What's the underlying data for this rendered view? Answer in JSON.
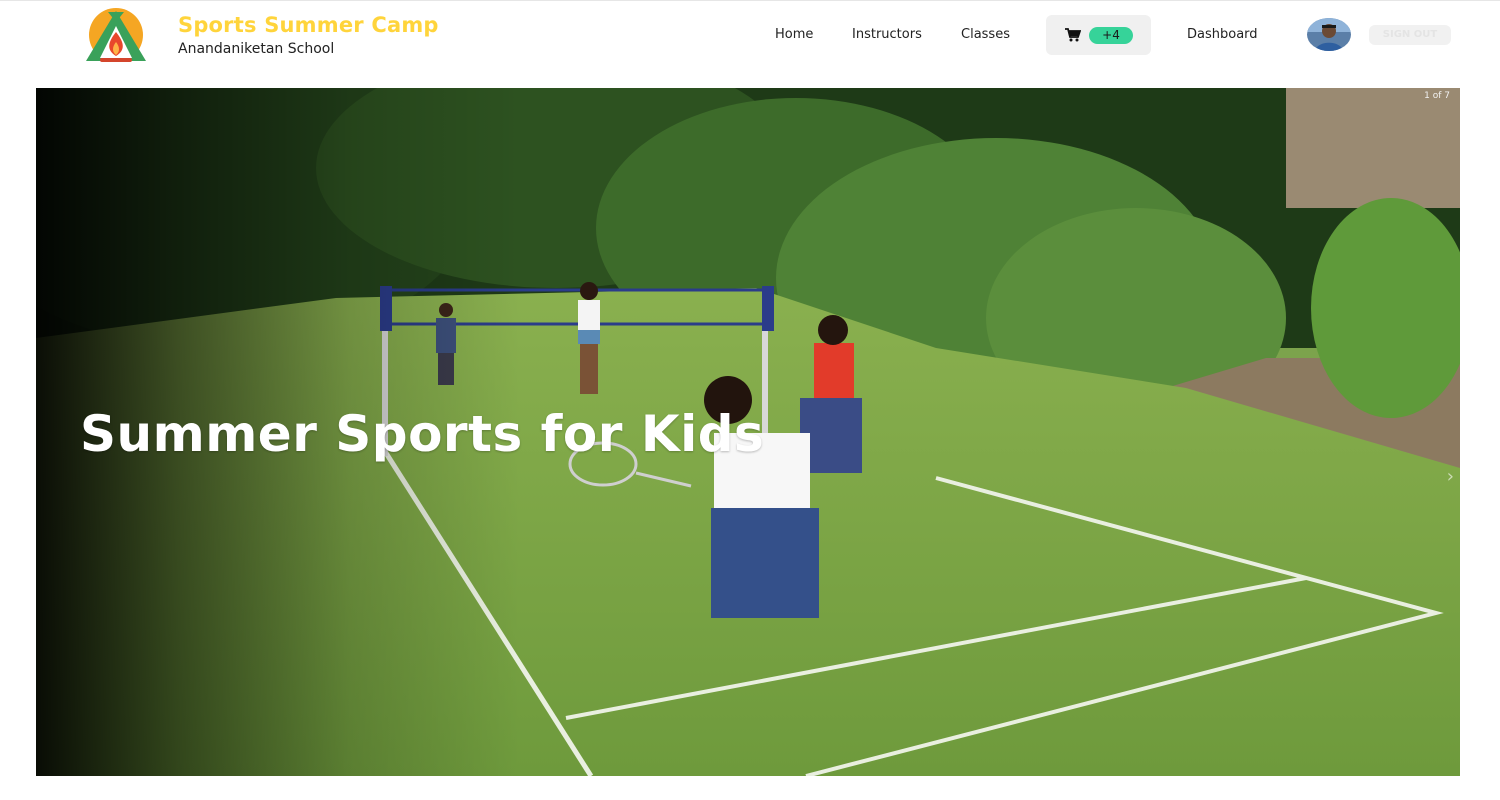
{
  "header": {
    "brand_title": "Sports Summer Camp",
    "brand_subtitle": "Anandaniketan School",
    "logo_icon": "campfire-tent-logo",
    "brand_color": "#ffd43b"
  },
  "nav": {
    "home": "Home",
    "instructors": "Instructors",
    "classes": "Classes",
    "cart_icon": "cart-icon",
    "cart_badge": "+4",
    "cart_badge_color": "#36d399",
    "dashboard": "Dashboard",
    "avatar_icon": "user-avatar",
    "sign_out": "SIGN OUT"
  },
  "hero": {
    "title": "Summer Sports for Kids",
    "slide_counter": "1 of 7",
    "next_icon": "chevron-right-icon"
  }
}
